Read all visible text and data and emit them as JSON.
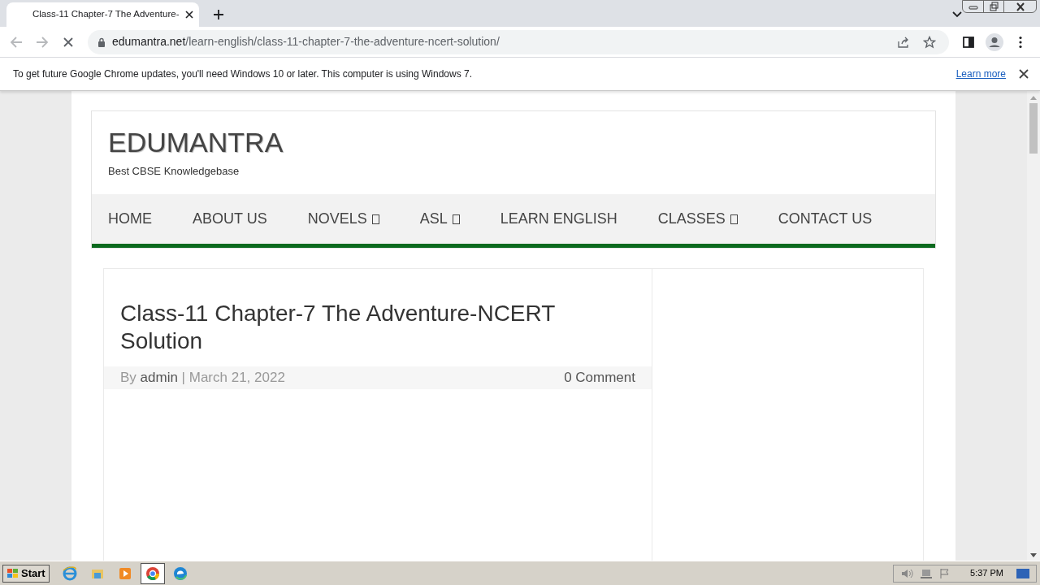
{
  "browser": {
    "tab_title": "Class-11 Chapter-7 The Adventure-",
    "url_domain": "edumantra.net",
    "url_path": "/learn-english/class-11-chapter-7-the-adventure-ncert-solution/",
    "loading": true
  },
  "infobar": {
    "message": "To get future Google Chrome updates, you'll need Windows 10 or later. This computer is using Windows 7.",
    "link": "Learn more"
  },
  "site": {
    "title": "EDUMANTRA",
    "tagline": "Best CBSE Knowledgebase"
  },
  "nav": [
    {
      "label": "HOME",
      "dropdown": false
    },
    {
      "label": "ABOUT US",
      "dropdown": false
    },
    {
      "label": "NOVELS",
      "dropdown": true
    },
    {
      "label": "ASL",
      "dropdown": true
    },
    {
      "label": "LEARN ENGLISH",
      "dropdown": false
    },
    {
      "label": "CLASSES",
      "dropdown": true
    },
    {
      "label": "CONTACT US",
      "dropdown": false
    }
  ],
  "post": {
    "title": "Class-11 Chapter-7 The Adventure-NCERT Solution",
    "by": "By",
    "author": "admin",
    "separator": "|",
    "date": "March 21, 2022",
    "comments": "0 Comment"
  },
  "taskbar": {
    "start": "Start",
    "apps": [
      {
        "kind": "ie",
        "selected": false
      },
      {
        "kind": "folder",
        "selected": false
      },
      {
        "kind": "media",
        "selected": false
      },
      {
        "kind": "chrome",
        "selected": true
      },
      {
        "kind": "edge",
        "selected": false
      }
    ],
    "clock": "5:37 PM"
  }
}
